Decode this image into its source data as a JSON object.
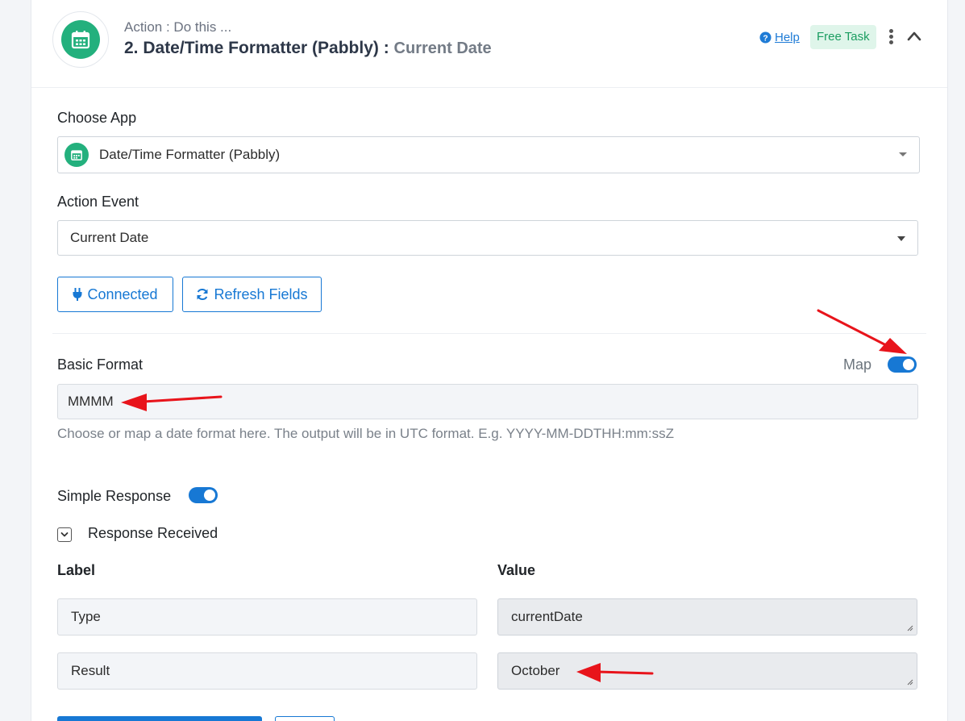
{
  "header": {
    "subtitle": "Action : Do this ...",
    "title": "2. Date/Time Formatter (Pabbly) :",
    "event": "Current Date",
    "help_label": "Help",
    "badge": "Free Task",
    "icon": "calendar-icon"
  },
  "choose_app": {
    "label": "Choose App",
    "value": "Date/Time Formatter (Pabbly)"
  },
  "action_event": {
    "label": "Action Event",
    "value": "Current Date"
  },
  "buttons": {
    "connected": "Connected",
    "refresh": "Refresh Fields"
  },
  "basic_format": {
    "label": "Basic Format",
    "map_label": "Map",
    "map_on": true,
    "value": "MMMM",
    "hint": "Choose or map a date format here. The output will be in UTC format. E.g. YYYY-MM-DDTHH:mm:ssZ"
  },
  "simple_response": {
    "label": "Simple Response",
    "on": true
  },
  "response": {
    "label": "Response Received",
    "col_label": "Label",
    "col_value": "Value",
    "rows": [
      {
        "label": "Type",
        "value": "currentDate"
      },
      {
        "label": "Result",
        "value": "October"
      }
    ]
  },
  "colors": {
    "primary": "#1778d4",
    "app_green": "#23b07d",
    "badge_bg": "#dff5ea",
    "annotation_red": "#e8141b"
  }
}
